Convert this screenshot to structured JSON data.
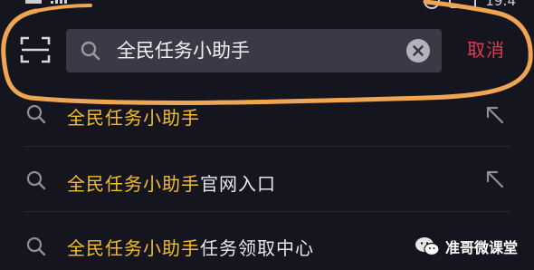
{
  "status_bar": {
    "time": "19:4"
  },
  "search": {
    "query": "全民任务小助手",
    "placeholder": "",
    "cancel_label": "取消"
  },
  "suggestions": [
    {
      "highlight": "全民任务小助手",
      "rest": ""
    },
    {
      "highlight": "全民任务小助手",
      "rest": "官网入口"
    },
    {
      "highlight": "全民任务小助手",
      "rest": "任务领取中心"
    }
  ],
  "watermark": {
    "text": "准哥微课堂"
  },
  "colors": {
    "background": "#15151f",
    "search_box": "#3a3a46",
    "highlight_text": "#f5bd2c",
    "cancel": "#e03c4e",
    "annotation_stroke": "#f0a552"
  }
}
